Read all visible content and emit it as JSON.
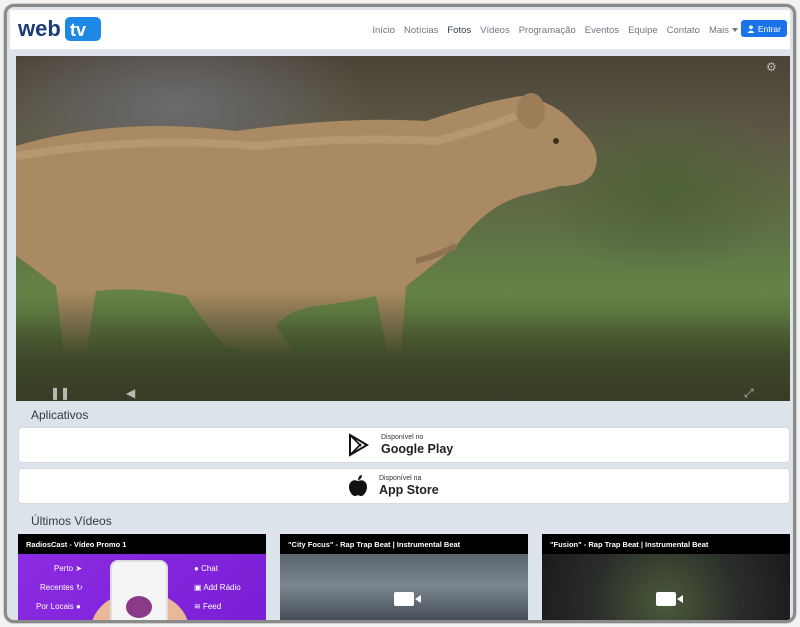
{
  "brand": {
    "logo_web": "web",
    "logo_tv": "tv"
  },
  "nav": {
    "links": [
      "Início",
      "Notícias",
      "Fotos",
      "Vídeos",
      "Programação",
      "Eventos",
      "Equipe",
      "Contato",
      "Mais"
    ],
    "active_index": 2,
    "login_label": "Entrar",
    "accent": "#1a73e8"
  },
  "apps": {
    "title": "Aplicativos",
    "google": {
      "small": "Disponível no",
      "big": "Google Play"
    },
    "apple": {
      "small": "Disponível na",
      "big": "App Store"
    }
  },
  "videos": {
    "title": "Últimos Vídeos",
    "items": [
      {
        "title": "RadiosCast - Vídeo Promo 1"
      },
      {
        "title": "\"City Focus\" - Rap Trap Beat | Instrumental Beat"
      },
      {
        "title": "\"Fusion\" - Rap Trap Beat | Instrumental Beat"
      }
    ],
    "promo_menu": {
      "left": [
        "Perto",
        "Recentes",
        "Por Locais"
      ],
      "right": [
        "Chat",
        "Add Rádio",
        "Feed"
      ]
    }
  }
}
